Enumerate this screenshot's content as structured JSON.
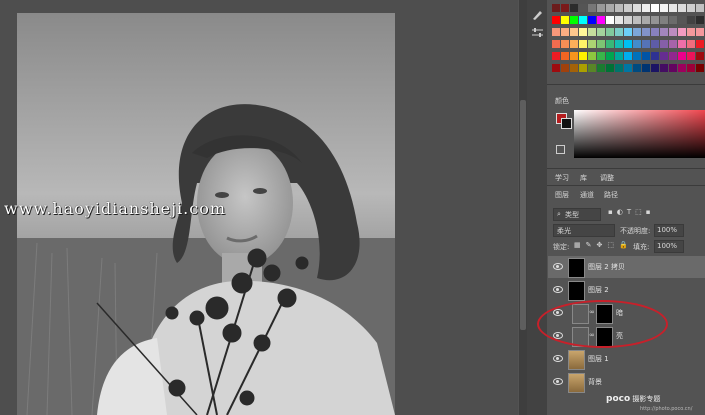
{
  "canvas": {
    "watermark": "www.haoyidiansheji.com"
  },
  "panels": {
    "color_tab": "颜色",
    "tabs_row": [
      "学习",
      "库",
      "调整"
    ],
    "layer_tabs": [
      "图层",
      "通道",
      "路径"
    ],
    "filter_kind": "类型",
    "blend_mode": "柔光",
    "opacity_label": "不透明度:",
    "opacity_value": "100%",
    "lock_label": "锁定:",
    "fill_label": "填充:",
    "fill_value": "100%"
  },
  "layers": [
    {
      "name": "图层 2 拷贝",
      "thumb": "black"
    },
    {
      "name": "图层 2",
      "thumb": "black"
    },
    {
      "name": "暗",
      "thumb": "mask"
    },
    {
      "name": "亮",
      "thumb": "mask"
    },
    {
      "name": "图层 1",
      "thumb": "photo"
    },
    {
      "name": "背景",
      "thumb": "photo"
    }
  ],
  "logo": {
    "brand": "poco",
    "text": "摄影专题",
    "url": "http://photo.poco.cn/"
  },
  "colors": {
    "foreground": "#b51d1f",
    "background": "#111111",
    "annotation": "#c8202a"
  }
}
